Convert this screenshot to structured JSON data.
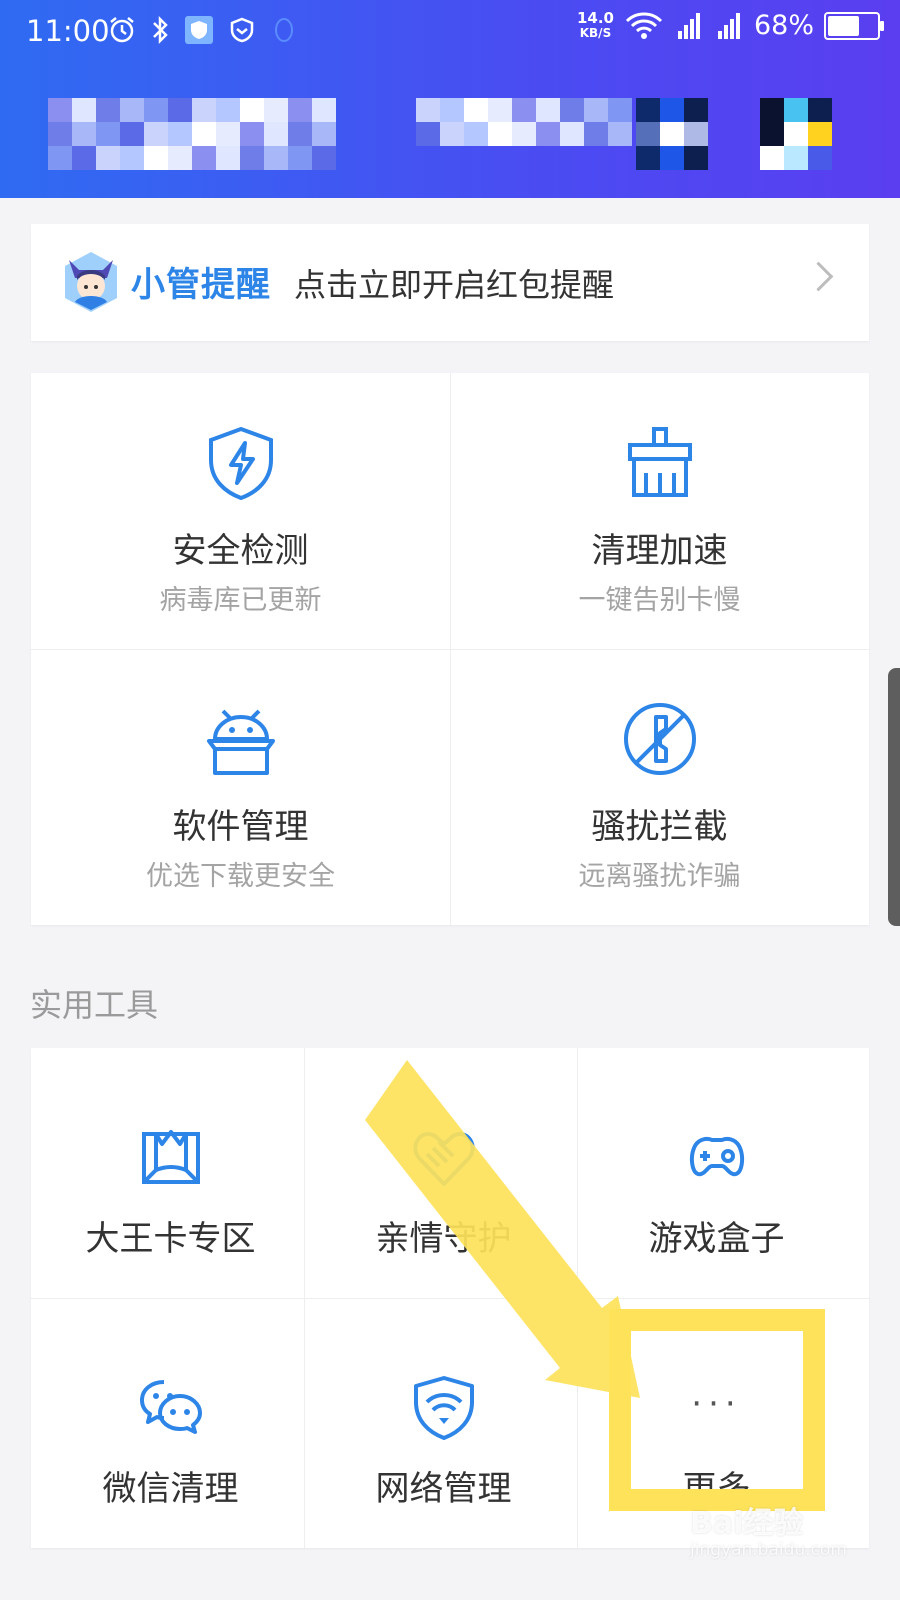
{
  "status_bar": {
    "time": "11:00",
    "net_speed_value": "14.0",
    "net_speed_unit": "KB/S",
    "battery": "68%",
    "battery_level": 0.68
  },
  "reminder": {
    "brand": "小管提醒",
    "text": "点击立即开启红包提醒"
  },
  "features": [
    {
      "title": "安全检测",
      "subtitle": "病毒库已更新",
      "icon": "shield-bolt-icon"
    },
    {
      "title": "清理加速",
      "subtitle": "一键告别卡慢",
      "icon": "broom-icon"
    },
    {
      "title": "软件管理",
      "subtitle": "优选下载更安全",
      "icon": "android-box-icon"
    },
    {
      "title": "骚扰拦截",
      "subtitle": "远离骚扰诈骗",
      "icon": "block-call-icon"
    }
  ],
  "tools_section": {
    "title": "实用工具",
    "items": [
      {
        "label": "大王卡专区",
        "icon": "king-card-icon"
      },
      {
        "label": "亲情守护",
        "icon": "heart-hand-icon"
      },
      {
        "label": "游戏盒子",
        "icon": "gamepad-icon"
      },
      {
        "label": "微信清理",
        "icon": "wechat-icon"
      },
      {
        "label": "网络管理",
        "icon": "wifi-shield-icon"
      },
      {
        "label": "更多",
        "icon": "more-dots-icon",
        "dots": "···"
      }
    ]
  },
  "watermark": {
    "brand": "Bai经验",
    "url": "jingyan.baidu.com"
  },
  "colors": {
    "accent": "#2d85e8",
    "highlight": "#fde25a"
  }
}
